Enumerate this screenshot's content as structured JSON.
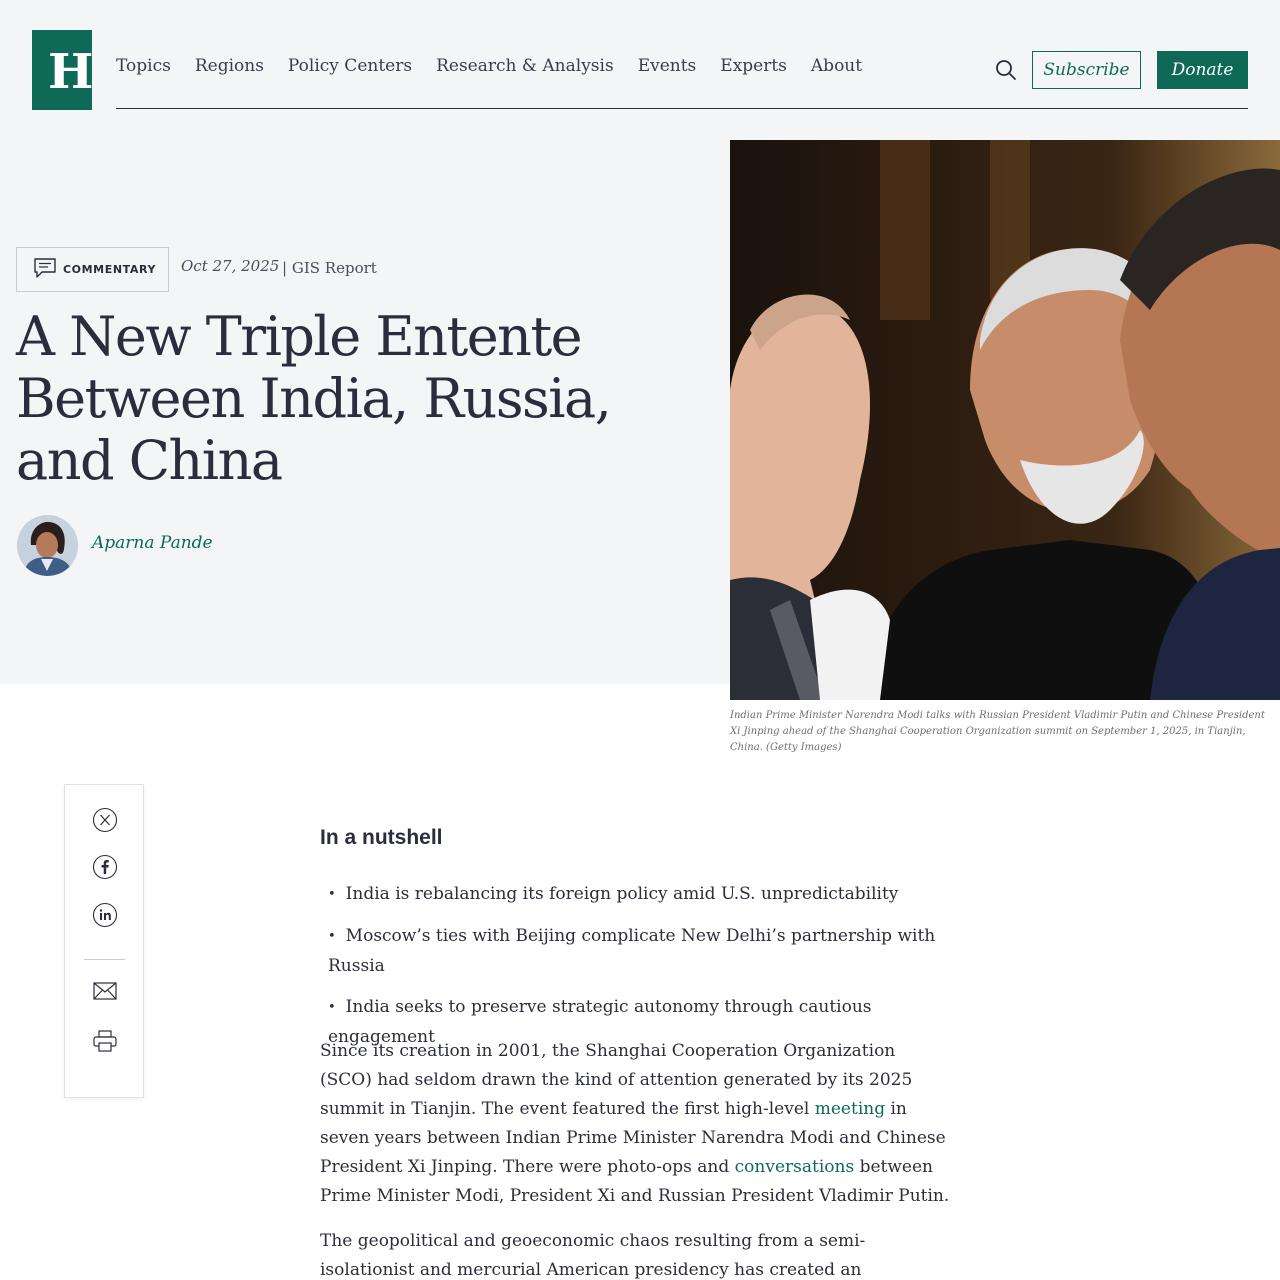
{
  "brand": {
    "logo_letter": "H",
    "accent": "#0e6a57"
  },
  "nav": {
    "items": [
      "Topics",
      "Regions",
      "Policy Centers",
      "Research & Analysis",
      "Events",
      "Experts",
      "About"
    ],
    "search_icon": "search-icon",
    "subscribe_label": "Subscribe",
    "donate_label": "Donate"
  },
  "article": {
    "badge_label": "COMMENTARY",
    "date": "Oct 27, 2025",
    "separator": "|",
    "series": "GIS Report",
    "title": "A New Triple Entente Between India, Russia, and China",
    "author": "Aparna Pande",
    "caption": "Indian Prime Minister Narendra Modi talks with Russian President Vladimir Putin and Chinese President Xi Jinping ahead of the Shanghai Cooperation Organization summit on September 1, 2025, in Tianjin, China. (Getty Images)"
  },
  "share": {
    "icons": [
      "x-icon",
      "facebook-icon",
      "linkedin-icon",
      "email-icon",
      "print-icon"
    ]
  },
  "body": {
    "nutshell_heading": "In a nutshell",
    "bullets": [
      "India is rebalancing its foreign policy amid U.S. unpredictability",
      "Moscow’s ties with Beijing complicate New Delhi’s partnership with Russia",
      "India seeks to preserve strategic autonomy through cautious engagement"
    ],
    "p1_a": "Since its creation in 2001, the Shanghai Cooperation Organization (SCO) had seldom drawn the kind of attention generated by its 2025 summit in Tianjin. The event featured the first high-level ",
    "p1_link1": "meeting",
    "p1_b": " in seven years between Indian Prime Minister Narendra Modi and Chinese President Xi Jinping. There were photo-ops and ",
    "p1_link2": "conversations",
    "p1_c": " between Prime Minister Modi, President Xi and Russian President Vladimir Putin.",
    "p2": "The geopolitical and geoeconomic chaos resulting from a semi-isolationist and mercurial American presidency has created an opportunity for China"
  }
}
